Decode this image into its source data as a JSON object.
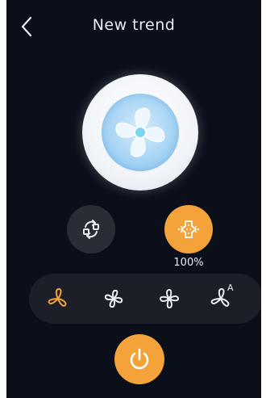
{
  "header": {
    "title": "New trend",
    "back_icon": "chevron-left-icon"
  },
  "fan": {
    "icon": "fan-blade-icon"
  },
  "controls": {
    "swing": {
      "icon": "oscillation-icon",
      "active": false
    },
    "purify": {
      "icon": "purifier-icon",
      "active": true,
      "value": "100%"
    }
  },
  "modes": {
    "items": [
      {
        "icon": "fan-mode-normal-icon",
        "active": true
      },
      {
        "icon": "fan-mode-natural-icon",
        "active": false
      },
      {
        "icon": "fan-mode-sleep-icon",
        "active": false
      },
      {
        "icon": "fan-mode-auto-icon",
        "active": false,
        "label": "A"
      }
    ]
  },
  "power": {
    "icon": "power-icon",
    "on": true
  },
  "colors": {
    "background": "#0b0f1a",
    "accent": "#f3a33a",
    "button_dark": "#2a2d35",
    "mode_bar": "#1c1f27",
    "text": "#e9edf2",
    "fan_blue": "#8cc7ef"
  }
}
